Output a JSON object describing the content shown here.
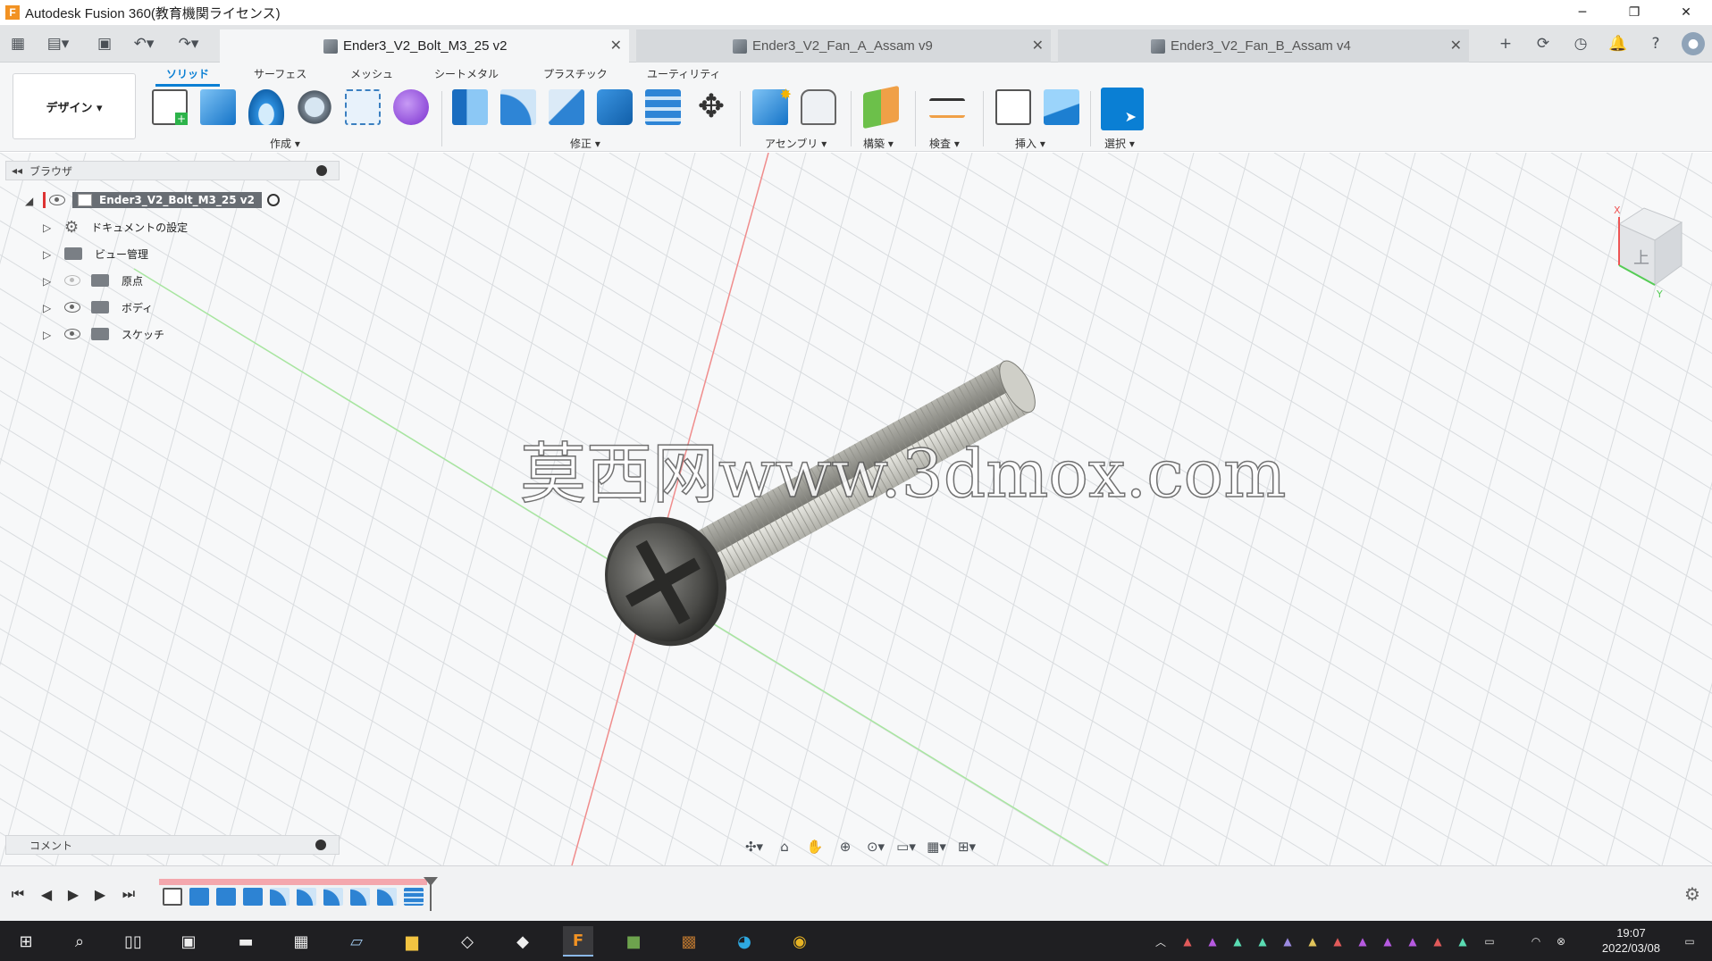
{
  "window": {
    "title": "Autodesk Fusion 360(教育機関ライセンス)",
    "minimize": "─",
    "restore": "❐",
    "close": "✕"
  },
  "tabs": [
    {
      "label": "Ender3_V2_Bolt_M3_25 v2",
      "active": true
    },
    {
      "label": "Ender3_V2_Fan_A_Assam v9",
      "active": false
    },
    {
      "label": "Ender3_V2_Fan_B_Assam v4",
      "active": false
    }
  ],
  "tab_close": "✕",
  "tab_add": "+",
  "ribbon": {
    "workspace": "デザイン ▾",
    "tabs": [
      "ソリッド",
      "サーフェス",
      "メッシュ",
      "シートメタル",
      "プラスチック",
      "ユーティリティ"
    ],
    "groups": [
      "作成 ▾",
      "修正 ▾",
      "アセンブリ ▾",
      "構築 ▾",
      "検査 ▾",
      "挿入 ▾",
      "選択 ▾"
    ]
  },
  "browser": {
    "title": "ブラウザ",
    "root": "Ender3_V2_Bolt_M3_25 v2",
    "items": [
      {
        "label": "ドキュメントの設定",
        "icon": "gear-icon"
      },
      {
        "label": "ビュー管理",
        "icon": "folder-icon"
      },
      {
        "label": "原点",
        "icon": "folder-icon",
        "visible": false
      },
      {
        "label": "ボディ",
        "icon": "folder-icon",
        "visible": true
      },
      {
        "label": "スケッチ",
        "icon": "folder-icon",
        "visible": true
      }
    ]
  },
  "comments_label": "コメント",
  "watermark": "莫西网www.3dmox.com",
  "viewcube": {
    "face": "上",
    "axis_x": "X",
    "axis_y": "Y"
  },
  "taskbar": {
    "time": "19:07",
    "date": "2022/03/08"
  },
  "colors": {
    "accent": "#0a7fd4",
    "ribbon_bg": "#f5f6f7",
    "tab_bar_bg": "#e2e4e6",
    "taskbar_bg": "#1f1f22",
    "timeline_red": "#f4a7ad"
  }
}
